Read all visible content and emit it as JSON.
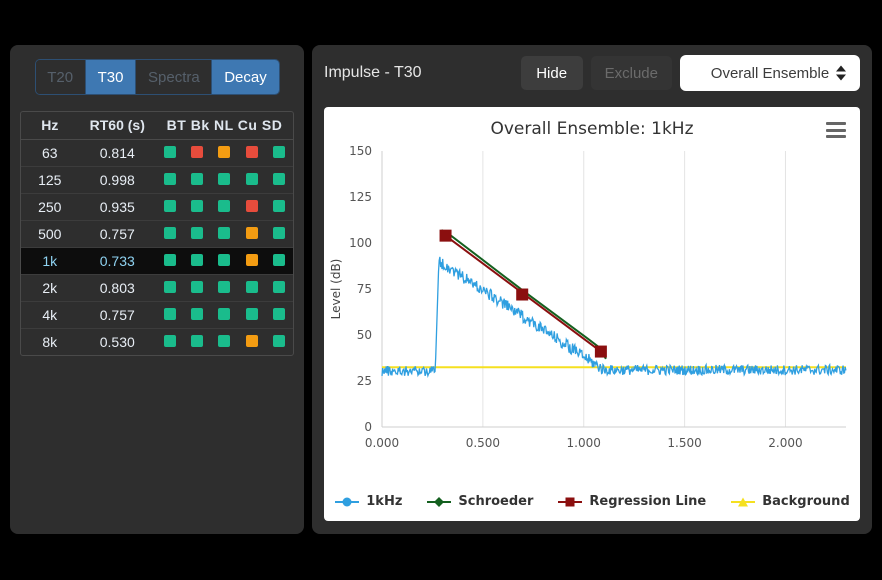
{
  "colors": {
    "page_bg": "#000000",
    "panel_bg": "#2e2e2e",
    "tab_active": "#3e78b2",
    "tab_disabled_text": "#56606b",
    "flag_good": "#1abc8c",
    "flag_warn": "#f39c12",
    "flag_bad": "#e74c3c",
    "series_1khz": "#2f9fe0",
    "series_schroeder": "#14601f",
    "series_regression": "#8b0f0f",
    "series_background": "#f5e020",
    "selected_row_text": "#8fd3f2"
  },
  "left_panel": {
    "tabs": [
      {
        "label": "T20",
        "state": "disabled"
      },
      {
        "label": "T30",
        "state": "active"
      },
      {
        "label": "Spectra",
        "state": "disabled"
      },
      {
        "label": "Decay",
        "state": "active"
      }
    ],
    "table": {
      "headers": [
        "Hz",
        "RT60 (s)",
        "BT",
        "Bk",
        "NL",
        "Cu",
        "SD"
      ],
      "flags_header_text": "BT Bk NL Cu SD",
      "rows": [
        {
          "hz": "63",
          "rt60": "0.814",
          "flags": [
            "good",
            "bad",
            "warn",
            "bad",
            "good"
          ],
          "selected": false
        },
        {
          "hz": "125",
          "rt60": "0.998",
          "flags": [
            "good",
            "good",
            "good",
            "good",
            "good"
          ],
          "selected": false
        },
        {
          "hz": "250",
          "rt60": "0.935",
          "flags": [
            "good",
            "good",
            "good",
            "bad",
            "good"
          ],
          "selected": false
        },
        {
          "hz": "500",
          "rt60": "0.757",
          "flags": [
            "good",
            "good",
            "good",
            "warn",
            "good"
          ],
          "selected": false
        },
        {
          "hz": "1k",
          "rt60": "0.733",
          "flags": [
            "good",
            "good",
            "good",
            "warn",
            "good"
          ],
          "selected": true
        },
        {
          "hz": "2k",
          "rt60": "0.803",
          "flags": [
            "good",
            "good",
            "good",
            "good",
            "good"
          ],
          "selected": false
        },
        {
          "hz": "4k",
          "rt60": "0.757",
          "flags": [
            "good",
            "good",
            "good",
            "good",
            "good"
          ],
          "selected": false
        },
        {
          "hz": "8k",
          "rt60": "0.530",
          "flags": [
            "good",
            "good",
            "good",
            "warn",
            "good"
          ],
          "selected": false
        }
      ]
    }
  },
  "right_panel": {
    "title": "Impulse - T30",
    "hide_button": "Hide",
    "exclude_button": "Exclude",
    "dropdown_value": "Overall Ensemble",
    "menu_icon": "hamburger-menu-icon"
  },
  "chart_data": {
    "type": "line",
    "title": "Overall Ensemble: 1kHz",
    "xlabel": "",
    "ylabel": "Level (dB)",
    "xlim": [
      0.0,
      2.3
    ],
    "ylim": [
      0,
      150
    ],
    "xticks": [
      "0.000",
      "0.500",
      "1.000",
      "1.500",
      "2.000"
    ],
    "xtick_values": [
      0.0,
      0.5,
      1.0,
      1.5,
      2.0
    ],
    "yticks": [
      "0",
      "25",
      "50",
      "75",
      "100",
      "125",
      "150"
    ],
    "ytick_values": [
      0,
      25,
      50,
      75,
      100,
      125,
      150
    ],
    "grid": "vertical",
    "legend_position": "bottom",
    "series": [
      {
        "name": "1kHz",
        "color": "#2f9fe0",
        "marker": "circle",
        "description": "Impulse response envelope: noise floor ~31 dB until 0.27 s, sharp rise to 91 dB peak, linear decay to noise floor by 1.10 s",
        "noise_floor_db": 31,
        "peak_db": 91,
        "onset_time_s": 0.27,
        "decay_end_time_s": 1.1
      },
      {
        "name": "Schroeder",
        "color": "#14601f",
        "marker": "diamond",
        "description": "Schroeder integration curve from 106 dB at 0.30 s decaying to 40 dB at 1.10 s with knee near the end",
        "points": [
          [
            0.295,
            107
          ],
          [
            0.33,
            105
          ],
          [
            0.7,
            74
          ],
          [
            1.02,
            48
          ],
          [
            1.08,
            43
          ],
          [
            1.11,
            37
          ]
        ]
      },
      {
        "name": "Regression Line",
        "color": "#8b0f0f",
        "marker": "square",
        "description": "Linear regression fit over the decay; square markers at endpoints and midpoint",
        "points": [
          [
            0.315,
            104
          ],
          [
            0.695,
            72
          ],
          [
            1.085,
            41
          ]
        ],
        "marker_points": [
          [
            0.315,
            104
          ],
          [
            0.695,
            72
          ],
          [
            1.085,
            41
          ]
        ]
      },
      {
        "name": "Background",
        "color": "#f5e020",
        "marker": "triangle",
        "description": "Constant background noise level line",
        "level_db": 32.5
      }
    ]
  }
}
